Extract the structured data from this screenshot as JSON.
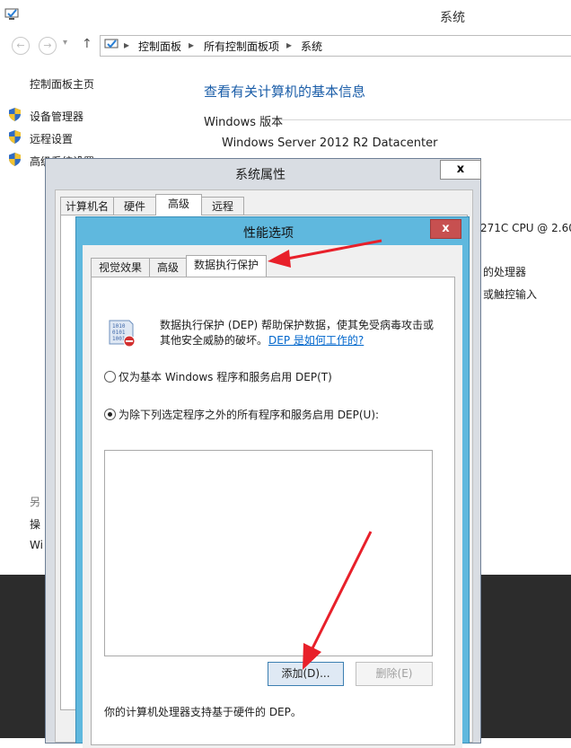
{
  "system_window": {
    "title": "系统",
    "breadcrumbs": [
      "控制面板",
      "所有控制面板项",
      "系统"
    ],
    "left_pane": {
      "home_link": "控制面板主页",
      "links": [
        "设备管理器",
        "远程设置",
        "高级系统设置"
      ],
      "see_also_partial": "另",
      "see_also_items_partial": [
        "操",
        "Wi"
      ]
    },
    "main": {
      "heading": "查看有关计算机的基本信息",
      "edition_label": "Windows 版本",
      "edition_value": "Windows Server 2012 R2 Datacenter",
      "cpu_partial": "271C CPU @ 2.60G",
      "processor_partial": "的处理器",
      "touch_partial": "或触控输入"
    }
  },
  "system_properties_dialog": {
    "title": "系统属性",
    "close_label": "x",
    "tabs": [
      "计算机名",
      "硬件",
      "高级",
      "远程"
    ],
    "active_tab": "高级"
  },
  "performance_options_dialog": {
    "title": "性能选项",
    "close_label": "x",
    "tabs": [
      "视觉效果",
      "高级",
      "数据执行保护"
    ],
    "active_tab": "数据执行保护",
    "description_line1": "数据执行保护 (DEP) 帮助保护数据，使其免受病毒攻击或",
    "description_line2": "其他安全威胁的破坏。",
    "help_link": "DEP 是如何工作的?",
    "options": [
      {
        "label": "仅为基本 Windows 程序和服务启用 DEP(T)",
        "selected": false
      },
      {
        "label": "为除下列选定程序之外的所有程序和服务启用 DEP(U):",
        "selected": true
      }
    ],
    "add_button": "添加(D)...",
    "remove_button": "删除(E)",
    "remove_enabled": false,
    "footer_text": "你的计算机处理器支持基于硬件的 DEP。"
  },
  "colors": {
    "accent_blue": "#5fb8de",
    "close_red": "#c75050",
    "link_blue": "#0066cc",
    "annotation_red": "#e8202a"
  },
  "annotations": [
    "red-arrow-to-dep-tab",
    "red-arrow-to-add-button"
  ]
}
